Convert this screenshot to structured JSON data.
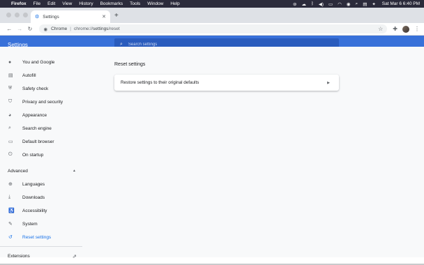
{
  "menubar": {
    "app": "Firefox",
    "items": [
      "File",
      "Edit",
      "View",
      "History",
      "Bookmarks",
      "Tools",
      "Window",
      "Help"
    ],
    "clock": "Sat Mar 6  6:40 PM",
    "tray_icons": [
      "creative-cloud-icon",
      "cloud-icon",
      "bluetooth-icon",
      "volume-icon",
      "battery-icon",
      "wifi-icon",
      "user-icon",
      "spotlight-icon",
      "control-center-icon",
      "siri-icon"
    ]
  },
  "browser": {
    "tab_title": "Settings",
    "new_tab": "+",
    "site_label": "Chrome",
    "url_scheme": "chrome://",
    "url_host": "settings",
    "url_path": "/reset"
  },
  "settings": {
    "title": "Settings",
    "search_placeholder": "Search settings",
    "sidebar": {
      "items": [
        {
          "label": "You and Google",
          "icon": "person-icon"
        },
        {
          "label": "Autofill",
          "icon": "clipboard-icon"
        },
        {
          "label": "Safety check",
          "icon": "shield-check-icon"
        },
        {
          "label": "Privacy and security",
          "icon": "shield-icon"
        },
        {
          "label": "Appearance",
          "icon": "palette-icon"
        },
        {
          "label": "Search engine",
          "icon": "search-icon"
        },
        {
          "label": "Default browser",
          "icon": "browser-icon"
        },
        {
          "label": "On startup",
          "icon": "power-icon"
        }
      ],
      "advanced_label": "Advanced",
      "advanced_items": [
        {
          "label": "Languages",
          "icon": "globe-icon"
        },
        {
          "label": "Downloads",
          "icon": "download-icon"
        },
        {
          "label": "Accessibility",
          "icon": "accessibility-icon"
        },
        {
          "label": "System",
          "icon": "wrench-icon"
        },
        {
          "label": "Reset settings",
          "icon": "restore-icon",
          "active": true
        }
      ],
      "extensions_label": "Extensions"
    },
    "main": {
      "section_title": "Reset settings",
      "restore_label": "Restore settings to their original defaults"
    }
  },
  "colors": {
    "header_blue": "#3871d9",
    "active_blue": "#1a73e8",
    "menubar_bg": "#2b2b3b"
  }
}
